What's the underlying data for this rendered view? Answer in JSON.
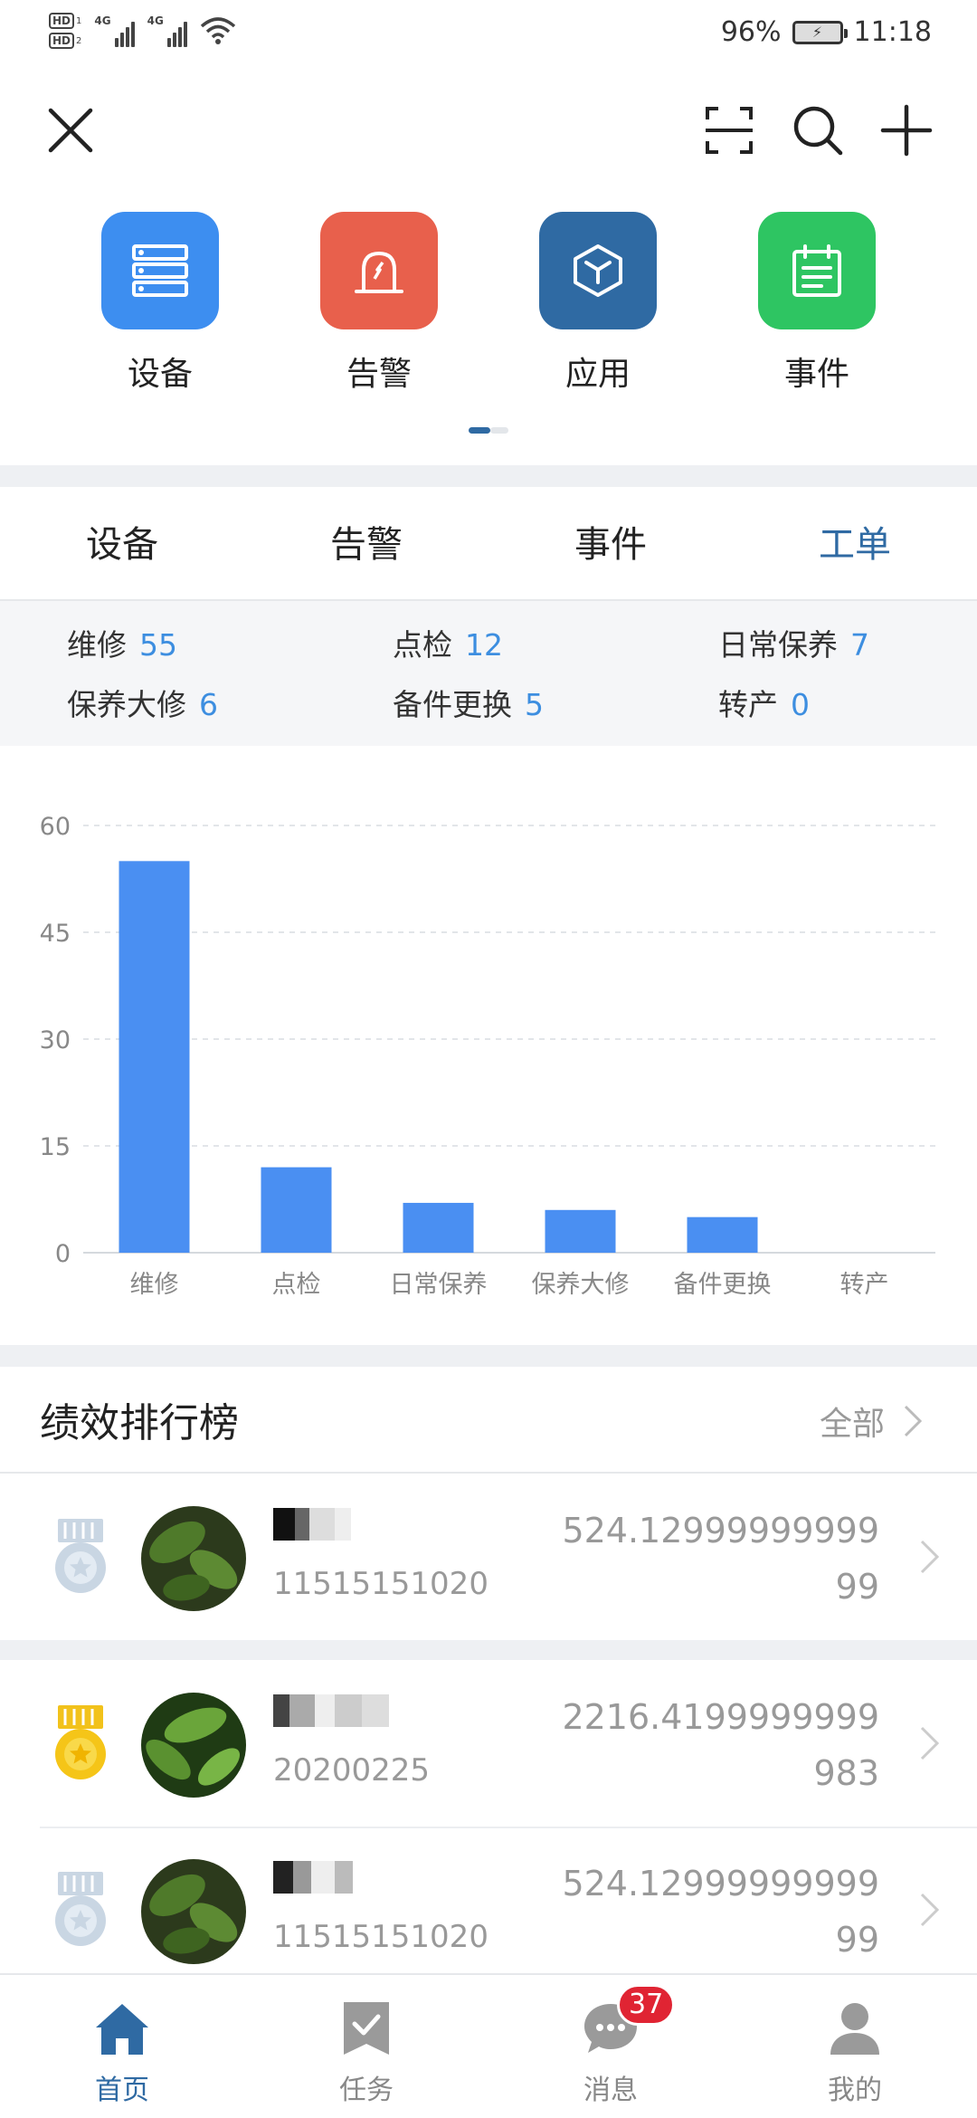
{
  "status_bar": {
    "hd1": "HD",
    "hd1_sub": "1",
    "hd2": "HD",
    "hd2_sub": "2",
    "net1": "4G",
    "net2": "4G",
    "battery_percent": "96%",
    "time": "11:18"
  },
  "toolbar": {
    "close_icon": "close-icon",
    "scan_icon": "scan-icon",
    "search_icon": "search-icon",
    "add_icon": "plus-icon"
  },
  "quick_menu": [
    {
      "label": "设备",
      "icon": "device-list-icon",
      "color": "#3d8ef0"
    },
    {
      "label": "告警",
      "icon": "alarm-light-icon",
      "color": "#e8604c"
    },
    {
      "label": "应用",
      "icon": "cube-icon",
      "color": "#2f6aa3"
    },
    {
      "label": "事件",
      "icon": "calendar-icon",
      "color": "#2ec562"
    }
  ],
  "tabs": [
    {
      "label": "设备"
    },
    {
      "label": "告警"
    },
    {
      "label": "事件"
    },
    {
      "label": "工单",
      "active": true
    }
  ],
  "stats": [
    {
      "label": "维修",
      "value": "55"
    },
    {
      "label": "点检",
      "value": "12"
    },
    {
      "label": "日常保养",
      "value": "7"
    },
    {
      "label": "保养大修",
      "value": "6"
    },
    {
      "label": "备件更换",
      "value": "5"
    },
    {
      "label": "转产",
      "value": "0"
    }
  ],
  "chart_data": {
    "type": "bar",
    "categories": [
      "维修",
      "点检",
      "日常保养",
      "保养大修",
      "备件更换",
      "转产"
    ],
    "values": [
      55,
      12,
      7,
      6,
      5,
      0
    ],
    "yticks": [
      "0",
      "15",
      "30",
      "45",
      "60"
    ],
    "ylim": [
      0,
      60
    ],
    "grid": true,
    "bar_color": "#4a8ff2"
  },
  "ranking": {
    "title": "绩效排行榜",
    "all_label": "全部",
    "rows": [
      {
        "medal": "silver-medal-icon",
        "id": "11515151020",
        "score": "524.1299999999999"
      },
      {
        "medal": "gold-medal-icon",
        "id": "20200225",
        "score": "2216.4199999999983"
      },
      {
        "medal": "silver-medal-icon",
        "id": "11515151020",
        "score": "524.1299999999999"
      }
    ]
  },
  "bottom_nav": [
    {
      "label": "首页",
      "icon": "home-icon",
      "active": true
    },
    {
      "label": "任务",
      "icon": "task-icon"
    },
    {
      "label": "消息",
      "icon": "message-icon",
      "badge": "37"
    },
    {
      "label": "我的",
      "icon": "user-icon"
    }
  ]
}
